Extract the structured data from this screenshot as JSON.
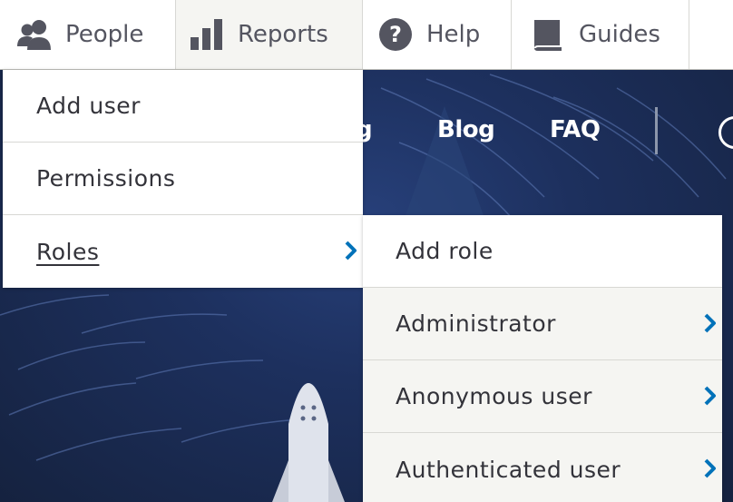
{
  "toolbar": {
    "tabs": [
      {
        "label": "People",
        "icon": "people-icon"
      },
      {
        "label": "Reports",
        "icon": "bar-chart-icon"
      },
      {
        "label": "Help",
        "icon": "help-icon"
      },
      {
        "label": "Guides",
        "icon": "book-icon"
      }
    ]
  },
  "site_nav": {
    "partial_link": "g",
    "blog": "Blog",
    "faq": "FAQ"
  },
  "people_menu": {
    "items": [
      {
        "label": "Add user"
      },
      {
        "label": "Permissions"
      },
      {
        "label": "Roles"
      }
    ]
  },
  "roles_menu": {
    "items": [
      {
        "label": "Add role"
      },
      {
        "label": "Administrator"
      },
      {
        "label": "Anonymous user"
      },
      {
        "label": "Authenticated user"
      }
    ]
  },
  "colors": {
    "toolbar_text": "#545560",
    "icon_gray": "#545560",
    "chevron_blue": "#0072b9",
    "menu_text": "#33333a",
    "submenu_bg": "#f5f5f2",
    "hero_bg": "#1d305e"
  }
}
